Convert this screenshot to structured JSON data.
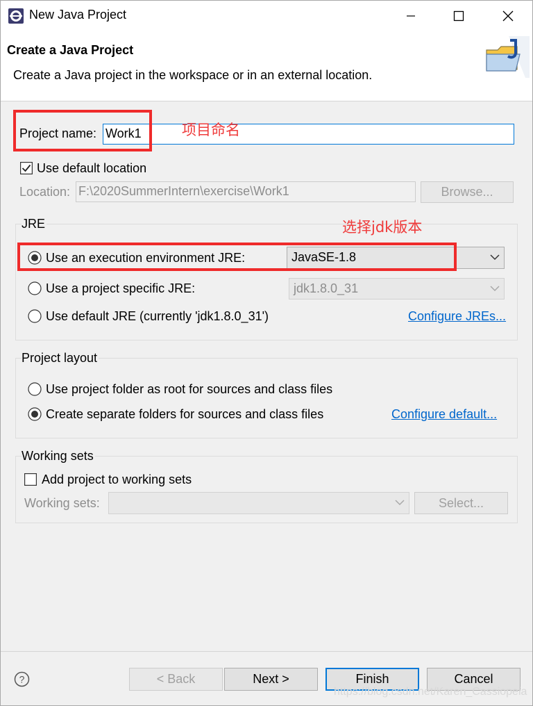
{
  "window": {
    "title": "New Java Project",
    "icon": "eclipse-icon",
    "controls": [
      "minimize-icon",
      "maximize-icon",
      "close-icon"
    ]
  },
  "header": {
    "title": "Create a Java Project",
    "description": "Create a Java project in the workspace or in an external location.",
    "icon": "java-folder-icon"
  },
  "project": {
    "name_label": "Project name:",
    "name_value": "Work1",
    "default_location_label": "Use default location",
    "default_location_checked": true,
    "location_label": "Location:",
    "location_value": "F:\\2020SummerIntern\\exercise\\Work1",
    "browse_label": "Browse..."
  },
  "jre": {
    "legend": "JRE",
    "options": [
      {
        "label": "Use an execution environment JRE:",
        "selected": true
      },
      {
        "label": "Use a project specific JRE:",
        "selected": false
      },
      {
        "label": "Use default JRE (currently 'jdk1.8.0_31')",
        "selected": false
      }
    ],
    "execution_env_value": "JavaSE-1.8",
    "specific_jre_value": "jdk1.8.0_31",
    "configure_link": "Configure JREs..."
  },
  "layout": {
    "legend": "Project layout",
    "options": [
      {
        "label": "Use project folder as root for sources and class files",
        "selected": false
      },
      {
        "label": "Create separate folders for sources and class files",
        "selected": true
      }
    ],
    "configure_link": "Configure default..."
  },
  "working_sets": {
    "legend": "Working sets",
    "add_label": "Add project to working sets",
    "add_checked": false,
    "sets_label": "Working sets:",
    "sets_value": "",
    "select_label": "Select..."
  },
  "annotations": {
    "name_note": "项目命名",
    "jre_note": "选择jdk版本"
  },
  "footer": {
    "help_icon": "help-icon",
    "back_label": "< Back",
    "next_label": "Next >",
    "finish_label": "Finish",
    "cancel_label": "Cancel"
  },
  "watermark": "https://blog.csdn.net/Karen_Cassiopeia"
}
